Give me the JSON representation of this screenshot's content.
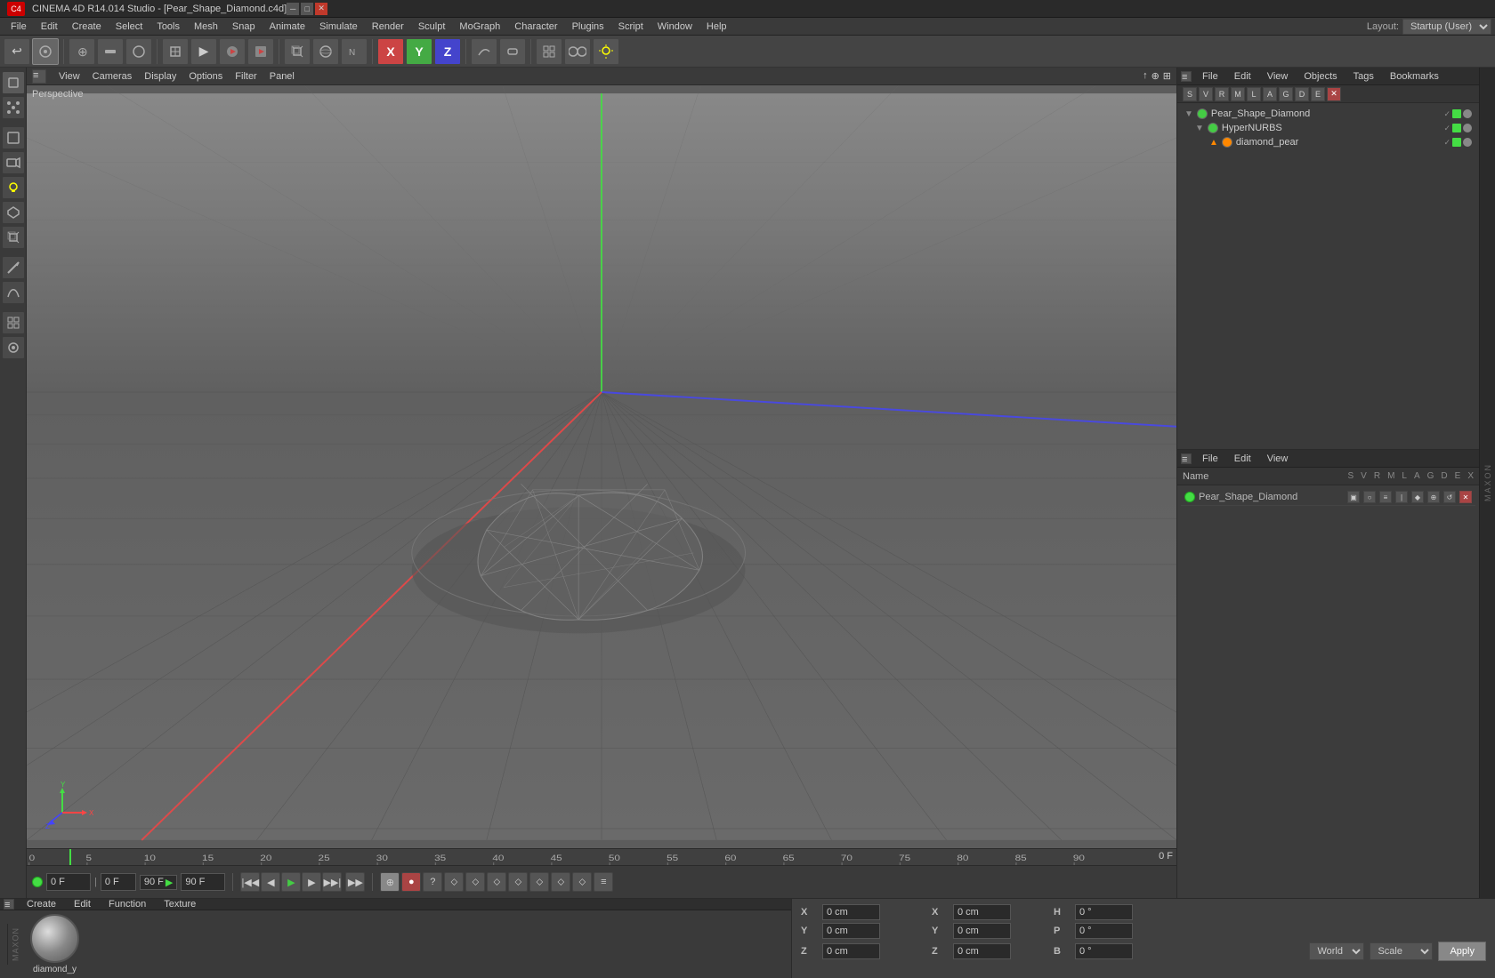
{
  "titlebar": {
    "title": "CINEMA 4D R14.014 Studio - [Pear_Shape_Diamond.c4d]",
    "controls": [
      "minimize",
      "restore",
      "close"
    ]
  },
  "menubar": {
    "items": [
      "File",
      "Edit",
      "Create",
      "Select",
      "Tools",
      "Mesh",
      "Snap",
      "Animate",
      "Simulate",
      "Render",
      "Sculpt",
      "MoGraph",
      "Character",
      "Plugins",
      "Script",
      "Window",
      "Help"
    ],
    "layout_label": "Layout:",
    "layout_value": "Startup (User)"
  },
  "viewport": {
    "perspective_label": "Perspective",
    "view_menu": [
      "View",
      "Cameras",
      "Display",
      "Options",
      "Filter",
      "Panel"
    ]
  },
  "object_manager": {
    "menus": [
      "File",
      "Edit",
      "View",
      "Objects",
      "Tags",
      "Bookmarks"
    ],
    "items": [
      {
        "label": "Pear_Shape_Diamond",
        "indent": 0,
        "dot_color": "green",
        "expanded": true
      },
      {
        "label": "HyperNURBS",
        "indent": 1,
        "dot_color": "green",
        "expanded": true
      },
      {
        "label": "diamond_pear",
        "indent": 2,
        "dot_color": "orange"
      }
    ]
  },
  "attr_manager": {
    "menus": [
      "File",
      "Edit",
      "View"
    ],
    "header_cols": [
      "Name",
      "S",
      "V",
      "R",
      "M",
      "L",
      "A",
      "G",
      "D",
      "E",
      "X"
    ],
    "items": [
      {
        "label": "Pear_Shape_Diamond",
        "dot_color": "green"
      }
    ]
  },
  "timeline": {
    "current_frame": "0 F",
    "end_frame": "90 F",
    "ticks": [
      0,
      5,
      10,
      15,
      20,
      25,
      30,
      35,
      40,
      45,
      50,
      55,
      60,
      65,
      70,
      75,
      80,
      85,
      90
    ]
  },
  "transport": {
    "start_frame": "0 F",
    "current_frame": "0 F",
    "end_frame": "90 F",
    "max_frame": "90 F"
  },
  "materials": {
    "toolbar": [
      "Create",
      "Edit",
      "Function",
      "Texture"
    ],
    "items": [
      {
        "label": "diamond_y",
        "type": "sphere"
      }
    ]
  },
  "coords": {
    "labels": {
      "x": "X",
      "y": "Y",
      "z": "Z"
    },
    "position": {
      "x": "0 cm",
      "y": "0 cm",
      "z": "0 cm"
    },
    "rotation": {
      "h": "0 °",
      "p": "0 °",
      "b": "0 °"
    },
    "scale": {
      "x": "0 cm",
      "y": "0 cm",
      "z": "0 cm"
    },
    "space_label": "World",
    "mode_label": "Scale",
    "apply_label": "Apply"
  }
}
